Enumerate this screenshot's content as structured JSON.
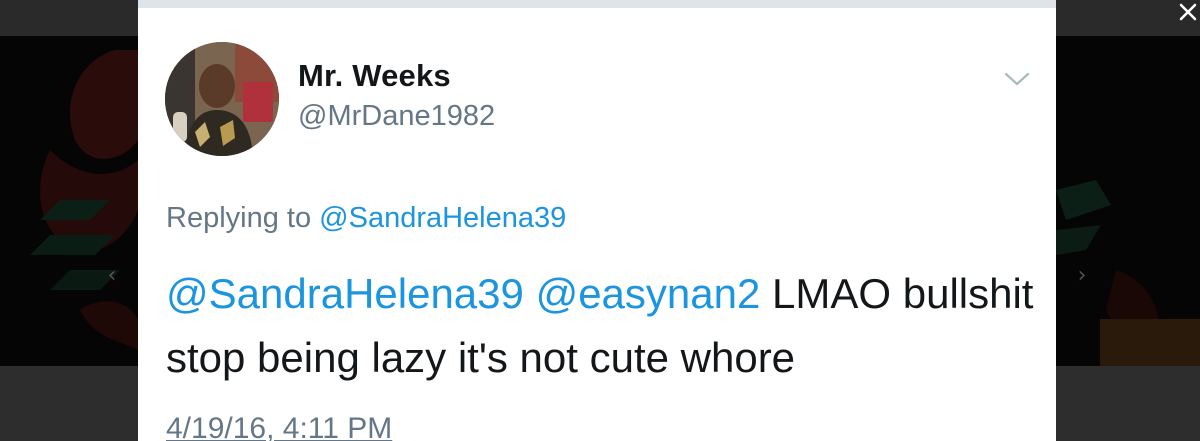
{
  "tweet": {
    "display_name": "Mr. Weeks",
    "handle": "@MrDane1982",
    "reply_prefix": "Replying to",
    "reply_to": "@SandraHelena39",
    "mention_1": "@SandraHelena39",
    "mention_2": "@easynan2",
    "body_text": "LMAO bullshit stop being lazy it's not cute whore",
    "timestamp": "4/19/16, 4:11 PM"
  },
  "icons": {
    "close": "close-icon",
    "caret": "chevron-down-icon",
    "prev": "chevron-left-icon",
    "next": "chevron-right-icon"
  },
  "colors": {
    "link": "#1b95e0",
    "secondary_text": "#657786",
    "primary_text": "#14171a",
    "card_bg": "#ffffff",
    "overlay_bg": "#050505"
  }
}
